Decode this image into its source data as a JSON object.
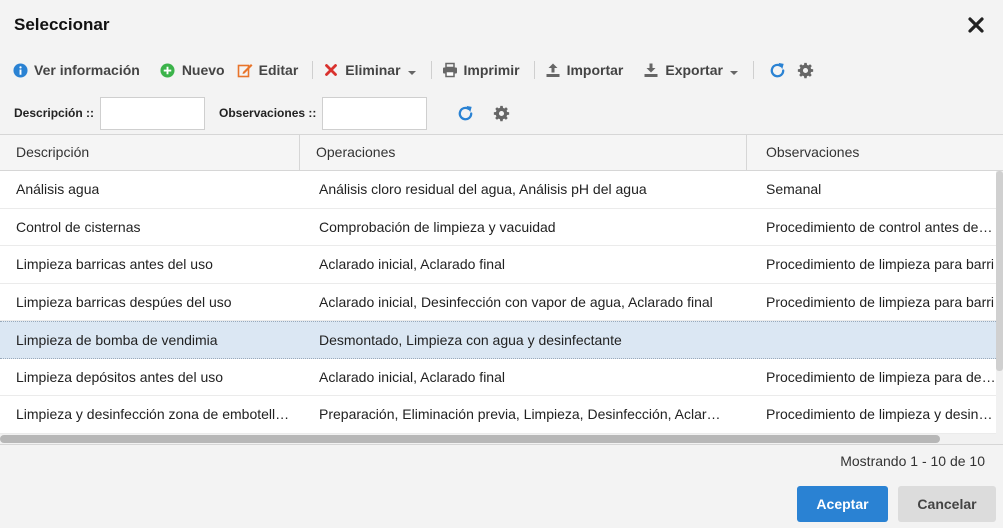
{
  "dialog": {
    "title": "Seleccionar"
  },
  "toolbar": {
    "info_label": "Ver información",
    "new_label": "Nuevo",
    "edit_label": "Editar",
    "delete_label": "Eliminar",
    "print_label": "Imprimir",
    "import_label": "Importar",
    "export_label": "Exportar"
  },
  "filters": {
    "description_label": "Descripción ::",
    "description_value": "",
    "observations_label": "Observaciones ::",
    "observations_value": ""
  },
  "grid": {
    "columns": [
      "Descripción",
      "Operaciones",
      "Observaciones"
    ],
    "rows": [
      [
        "Análisis agua",
        "Análisis cloro residual del agua, Análisis pH del agua",
        "Semanal"
      ],
      [
        "Control de cisternas",
        "Comprobación de limpieza y vacuidad",
        "Procedimiento de control antes de ex"
      ],
      [
        "Limpieza barricas antes del uso",
        "Aclarado inicial, Aclarado final",
        "Procedimiento de limpieza para barri"
      ],
      [
        "Limpieza barricas despúes del uso",
        "Aclarado inicial, Desinfección con vapor de agua, Aclarado final",
        "Procedimiento de limpieza para barri"
      ],
      [
        "Limpieza de bomba de vendimia",
        "Desmontado, Limpieza con agua y desinfectante",
        ""
      ],
      [
        "Limpieza depósitos antes del uso",
        "Aclarado inicial, Aclarado final",
        "Procedimiento de limpieza para depó"
      ],
      [
        "Limpieza y desinfección zona de embotellado",
        "Preparación, Eliminación previa, Limpieza, Desinfección, Aclarado final",
        "Procedimiento de limpieza y desinfec"
      ]
    ],
    "selected_row": 4
  },
  "paging": {
    "text": "Mostrando 1 - 10 de 10"
  },
  "actions": {
    "ok_label": "Aceptar",
    "cancel_label": "Cancelar"
  },
  "colors": {
    "accent": "#2a82d3",
    "info_icon": "#2a82d3",
    "new_icon": "#3bb34a",
    "edit_icon": "#e8742a",
    "delete_icon": "#d9322e",
    "selected_row": "#dbe7f3"
  },
  "icons": {
    "close": "close-icon",
    "info": "info-icon",
    "new": "plus-circle-icon",
    "edit": "pencil-icon",
    "delete": "x-icon",
    "print": "printer-icon",
    "import": "upload-icon",
    "export": "download-icon",
    "refresh": "refresh-icon",
    "settings": "gear-icon"
  }
}
